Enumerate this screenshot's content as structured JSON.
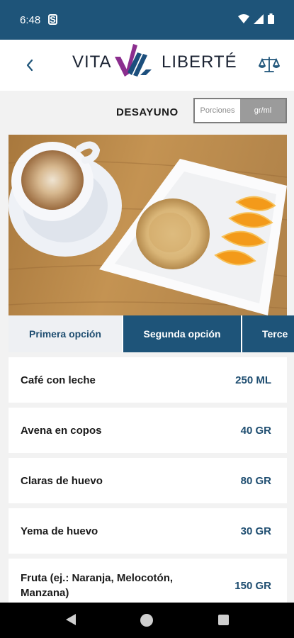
{
  "status_bar": {
    "time": "6:48",
    "indicator": "S"
  },
  "header": {
    "back_icon": "chevron-left-icon",
    "logo_left": "VITA",
    "logo_right": "LIBERTÉ",
    "scale_icon": "balance-scale-icon",
    "colors": {
      "header_bar": "#1e5479",
      "logo_purple": "#8b2e8e",
      "logo_blue": "#1c4f7d"
    }
  },
  "meal": {
    "title": "DESAYUNO",
    "unit_options": [
      "Porciones",
      "gr/ml"
    ],
    "selected_unit": "gr/ml"
  },
  "tabs": [
    {
      "label": "Primera opción",
      "selected": true
    },
    {
      "label": "Segunda opción",
      "selected": false
    },
    {
      "label": "Terce",
      "selected": false
    }
  ],
  "foods": [
    {
      "name": "Café con leche",
      "qty": "250 ML"
    },
    {
      "name": "Avena en copos",
      "qty": "40 GR"
    },
    {
      "name": "Claras de huevo",
      "qty": "80 GR"
    },
    {
      "name": "Yema de huevo",
      "qty": "30 GR"
    },
    {
      "name": "Fruta (ej.: Naranja, Melocotón, Manzana)",
      "qty": "150 GR"
    }
  ],
  "nav": {
    "back_icon": "triangle-back-icon",
    "home_icon": "circle-home-icon",
    "recent_icon": "square-recents-icon"
  }
}
